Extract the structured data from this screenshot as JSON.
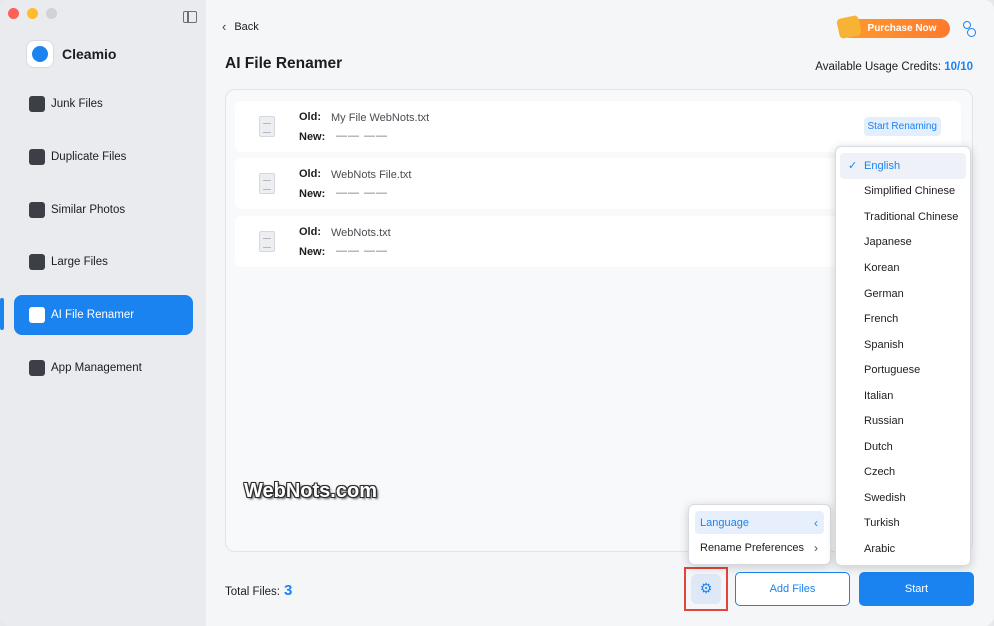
{
  "app": {
    "name": "Cleamio"
  },
  "sidebar": {
    "items": [
      {
        "label": "Junk Files",
        "icon": "junk-files-icon"
      },
      {
        "label": "Duplicate Files",
        "icon": "folder-icon"
      },
      {
        "label": "Similar Photos",
        "icon": "photo-icon"
      },
      {
        "label": "Large Files",
        "icon": "large-files-icon"
      },
      {
        "label": "AI File Renamer",
        "icon": "ai-file-icon"
      },
      {
        "label": "App Management",
        "icon": "app-store-icon"
      }
    ],
    "active_index": 4
  },
  "header": {
    "back_label": "Back",
    "purchase_label": "Purchase Now",
    "title": "AI File Renamer",
    "credits_label": "Available Usage Credits:",
    "credits_value": "10/10"
  },
  "files": {
    "old_label": "Old:",
    "new_label": "New:",
    "items": [
      {
        "old": "My File WebNots.txt",
        "new": "—— ——"
      },
      {
        "old": "WebNots File.txt",
        "new": "—— ——"
      },
      {
        "old": "WebNots.txt",
        "new": "—— ——"
      }
    ],
    "start_renaming_label": "Start Renaming"
  },
  "watermark": "WebNots.com",
  "footer": {
    "total_label": "Total Files:",
    "total_count": "3",
    "add_files_label": "Add Files",
    "start_label": "Start"
  },
  "settings_menu": {
    "items": [
      {
        "label": "Language",
        "arrow": "‹"
      },
      {
        "label": "Rename Preferences",
        "arrow": "›"
      }
    ]
  },
  "language_menu": {
    "selected": "English",
    "items": [
      "English",
      "Simplified Chinese",
      "Traditional Chinese",
      "Japanese",
      "Korean",
      "German",
      "French",
      "Spanish",
      "Portuguese",
      "Italian",
      "Russian",
      "Dutch",
      "Czech",
      "Swedish",
      "Turkish",
      "Arabic"
    ]
  },
  "colors": {
    "accent": "#1b83f0",
    "purchase": "#ff8a2e",
    "highlight_border": "#e2453b"
  }
}
